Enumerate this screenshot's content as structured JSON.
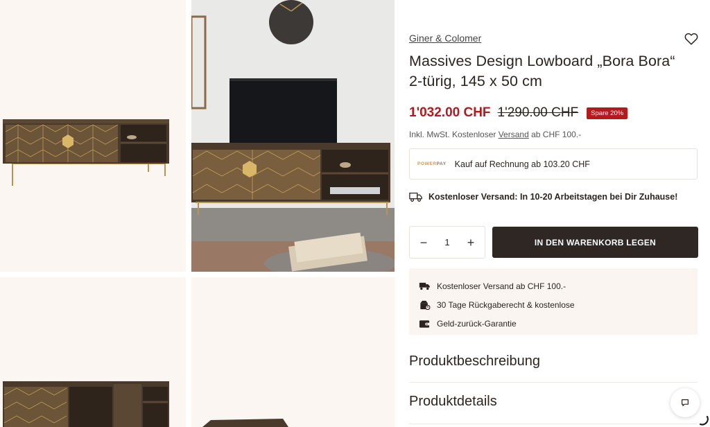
{
  "product": {
    "brand": "Giner & Colomer",
    "title_line1": "Massives Design Lowboard „Bora Bora“",
    "title_line2": "2-türig, 145 x 50 cm",
    "price_current": "1'032.00 CHF",
    "price_old": "1'290.00 CHF",
    "discount_badge": "Spare 20%",
    "tax_prefix": "Inkl. MwSt. Kostenloser ",
    "tax_link": "Versand",
    "tax_suffix": " ab CHF 100.-"
  },
  "powerpay": {
    "logo_a": "POWER",
    "logo_b": "PAY",
    "text": "Kauf auf Rechnung ab 103.20 CHF"
  },
  "shipping_notice": "Kostenloser Versand: In 10-20 Arbeitstagen bei Dir Zuhause!",
  "quantity": {
    "value": "1",
    "minus": "−",
    "plus": "+"
  },
  "cart_button": "IN DEN WARENKORB LEGEN",
  "usps": [
    {
      "icon": "truck-icon",
      "text": "Kostenloser Versand ab CHF 100.-"
    },
    {
      "icon": "return-box-icon",
      "text": "30 Tage Rückgaberecht & kostenlose"
    },
    {
      "icon": "wallet-icon",
      "text": "Geld-zurück-Garantie"
    }
  ],
  "accordions": [
    {
      "label": "Produktbeschreibung"
    },
    {
      "label": "Produktdetails"
    }
  ],
  "colors": {
    "price_red": "#b3191e",
    "button_dark": "#2e2724",
    "panel_bg": "#faf5f1"
  }
}
